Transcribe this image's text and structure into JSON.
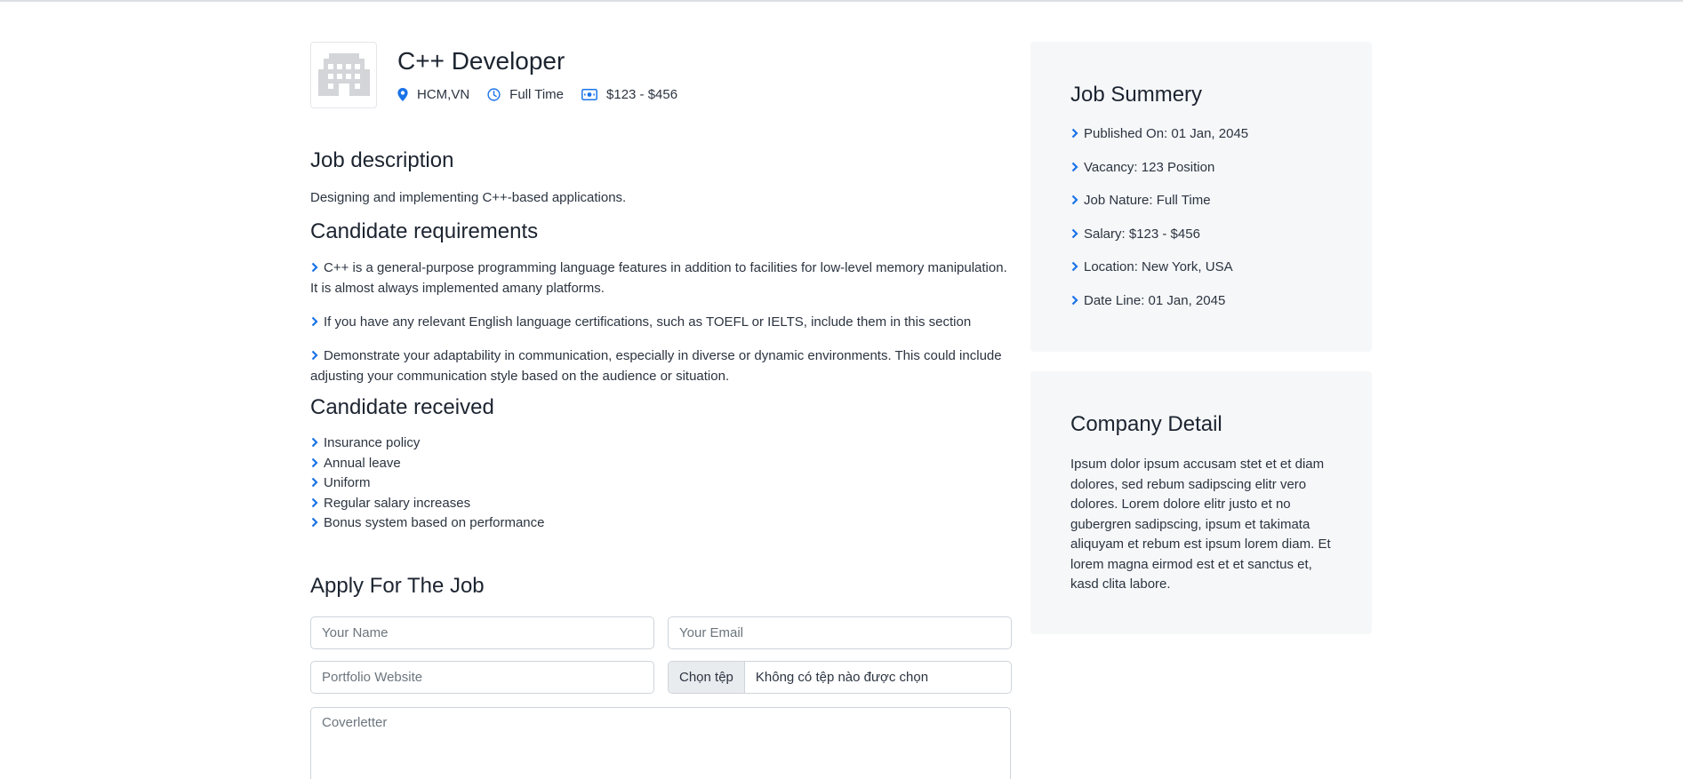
{
  "job": {
    "title": "C++ Developer",
    "location": "HCM,VN",
    "type": "Full Time",
    "salary": "$123 - $456"
  },
  "description": {
    "heading": "Job description",
    "text": "Designing and implementing C++-based applications."
  },
  "requirements": {
    "heading": "Candidate requirements",
    "items": [
      "C++ is a general-purpose programming language features in addition to facilities for low-level memory manipulation. It is almost always implemented amany platforms.",
      "If you have any relevant English language certifications, such as TOEFL or IELTS, include them in this section",
      "Demonstrate your adaptability in communication, especially in diverse or dynamic environments. This could include adjusting your communication style based on the audience or situation."
    ]
  },
  "received": {
    "heading": "Candidate received",
    "items": [
      "Insurance policy",
      "Annual leave",
      "Uniform",
      "Regular salary increases",
      "Bonus system based on performance"
    ]
  },
  "apply": {
    "heading": "Apply For The Job",
    "name_placeholder": "Your Name",
    "email_placeholder": "Your Email",
    "portfolio_placeholder": "Portfolio Website",
    "file_button": "Chọn tệp",
    "file_status": "Không có tệp nào được chọn",
    "cover_placeholder": "Coverletter"
  },
  "summary": {
    "heading": "Job Summery",
    "items": [
      "Published On: 01 Jan, 2045",
      "Vacancy: 123 Position",
      "Job Nature: Full Time",
      "Salary: $123 - $456",
      "Location: New York, USA",
      "Date Line: 01 Jan, 2045"
    ]
  },
  "company": {
    "heading": "Company Detail",
    "text": "Ipsum dolor ipsum accusam stet et et diam dolores, sed rebum sadipscing elitr vero dolores. Lorem dolore elitr justo et no gubergren sadipscing, ipsum et takimata aliquyam et rebum est ipsum lorem diam. Et lorem magna eirmod est et et sanctus et, kasd clita labore."
  },
  "colors": {
    "accent": "#1a73e8",
    "card_bg": "#f6f7f9"
  }
}
